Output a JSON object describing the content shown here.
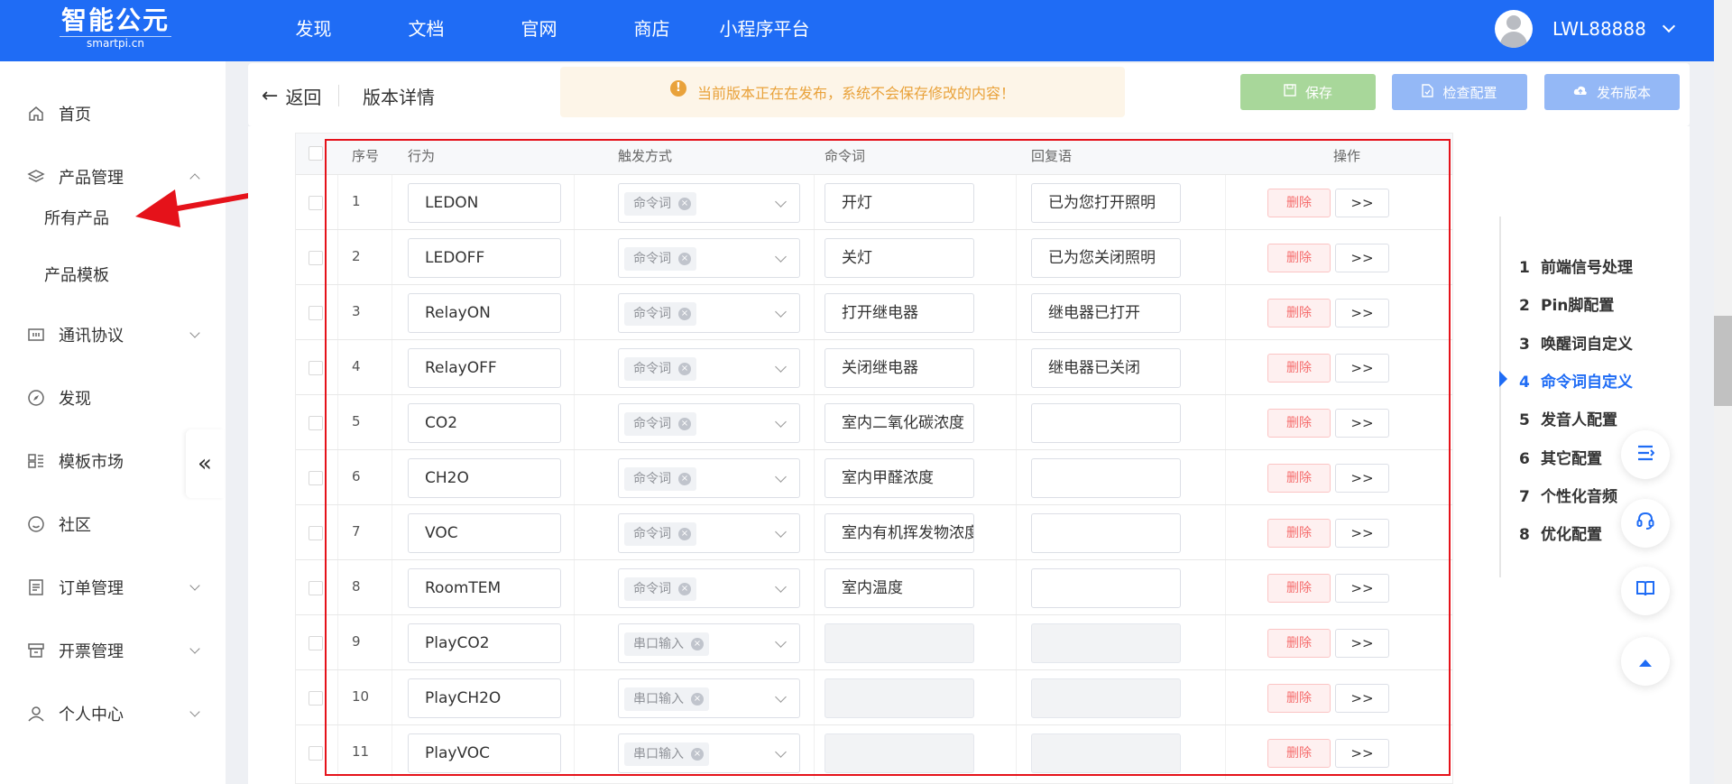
{
  "brand": {
    "name": "智能公元",
    "domain": "smartpi.cn"
  },
  "topnav": [
    "发现",
    "文档",
    "官网",
    "商店",
    "小程序平台"
  ],
  "user": {
    "name": "LWL88888"
  },
  "sidebar": {
    "items": [
      {
        "label": "首页",
        "icon": "home-icon"
      },
      {
        "label": "产品管理",
        "icon": "layers-icon"
      },
      {
        "label": "通讯协议",
        "icon": "protocol-icon"
      },
      {
        "label": "发现",
        "icon": "compass-icon"
      },
      {
        "label": "模板市场",
        "icon": "template-icon"
      },
      {
        "label": "社区",
        "icon": "smile-icon"
      },
      {
        "label": "订单管理",
        "icon": "order-icon"
      },
      {
        "label": "开票管理",
        "icon": "invoice-icon"
      },
      {
        "label": "个人中心",
        "icon": "user-icon"
      }
    ],
    "subitems": [
      "所有产品",
      "产品模板"
    ],
    "collapse_glyph": "«"
  },
  "header": {
    "back": "返回",
    "title": "版本详情",
    "notice": "当前版本正在在发布，系统不会保存修改的内容！",
    "save": "保存",
    "check": "检查配置",
    "publish": "发布版本"
  },
  "table": {
    "columns": [
      "序号",
      "行为",
      "触发方式",
      "命令词",
      "回复语",
      "操作"
    ],
    "delete_label": "删除",
    "more_label": ">>",
    "rows": [
      {
        "idx": "1",
        "action": "LEDON",
        "trigger": "命令词",
        "command": "开灯",
        "reply": "已为您打开照明",
        "disabled": false
      },
      {
        "idx": "2",
        "action": "LEDOFF",
        "trigger": "命令词",
        "command": "关灯",
        "reply": "已为您关闭照明",
        "disabled": false
      },
      {
        "idx": "3",
        "action": "RelayON",
        "trigger": "命令词",
        "command": "打开继电器",
        "reply": "继电器已打开",
        "disabled": false
      },
      {
        "idx": "4",
        "action": "RelayOFF",
        "trigger": "命令词",
        "command": "关闭继电器",
        "reply": "继电器已关闭",
        "disabled": false
      },
      {
        "idx": "5",
        "action": "CO2",
        "trigger": "命令词",
        "command": "室内二氧化碳浓度",
        "reply": "",
        "disabled": false
      },
      {
        "idx": "6",
        "action": "CH2O",
        "trigger": "命令词",
        "command": "室内甲醛浓度",
        "reply": "",
        "disabled": false
      },
      {
        "idx": "7",
        "action": "VOC",
        "trigger": "命令词",
        "command": "室内有机挥发物浓度",
        "reply": "",
        "disabled": false
      },
      {
        "idx": "8",
        "action": "RoomTEM",
        "trigger": "命令词",
        "command": "室内温度",
        "reply": "",
        "disabled": false
      },
      {
        "idx": "9",
        "action": "PlayCO2",
        "trigger": "串口输入",
        "command": "",
        "reply": "",
        "disabled": true
      },
      {
        "idx": "10",
        "action": "PlayCH2O",
        "trigger": "串口输入",
        "command": "",
        "reply": "",
        "disabled": true
      },
      {
        "idx": "11",
        "action": "PlayVOC",
        "trigger": "串口输入",
        "command": "",
        "reply": "",
        "disabled": true
      }
    ]
  },
  "steps": [
    {
      "num": "1",
      "label": "前端信号处理",
      "active": false
    },
    {
      "num": "2",
      "label": "Pin脚配置",
      "active": false
    },
    {
      "num": "3",
      "label": "唤醒词自定义",
      "active": false
    },
    {
      "num": "4",
      "label": "命令词自定义",
      "active": true
    },
    {
      "num": "5",
      "label": "发音人配置",
      "active": false
    },
    {
      "num": "6",
      "label": "其它配置",
      "active": false
    },
    {
      "num": "7",
      "label": "个性化音频",
      "active": false
    },
    {
      "num": "8",
      "label": "优化配置",
      "active": false
    }
  ],
  "colors": {
    "primary": "#1f6cf5",
    "danger": "#f56c6c",
    "annotation": "#e5121a",
    "warning": "#e9a23b"
  }
}
